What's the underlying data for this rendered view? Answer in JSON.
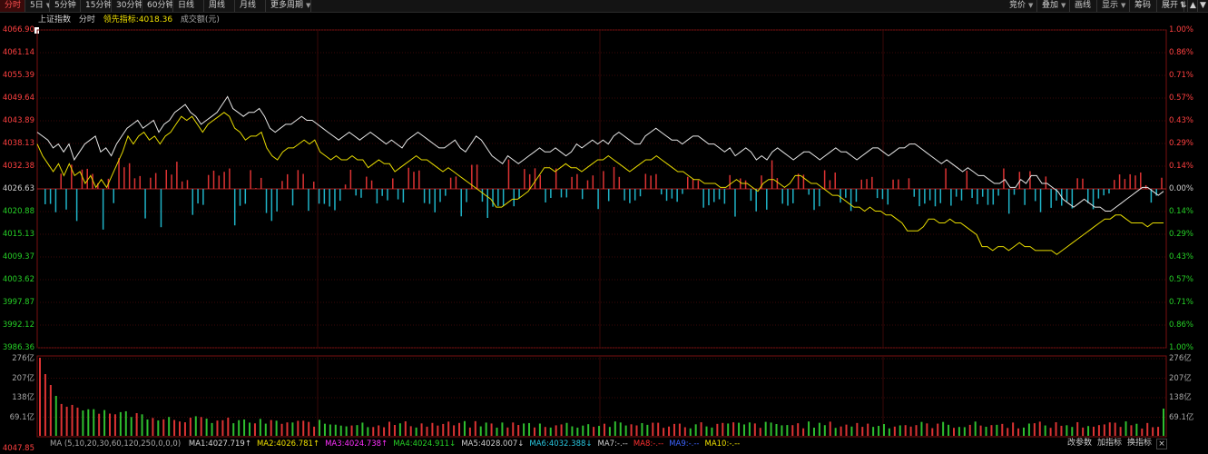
{
  "toolbar": {
    "left": [
      {
        "label": "分时",
        "active": true
      },
      {
        "label": "5日",
        "dropdown": true
      },
      {
        "label": "5分钟"
      },
      {
        "label": "15分钟"
      },
      {
        "label": "30分钟"
      },
      {
        "label": "60分钟"
      },
      {
        "label": "日线"
      },
      {
        "label": "周线"
      },
      {
        "label": "月线"
      },
      {
        "label": "更多周期",
        "dropdown": true
      }
    ],
    "right": [
      {
        "label": "竞价",
        "dropdown": true
      },
      {
        "label": "叠加",
        "dropdown": true
      },
      {
        "label": "画线"
      },
      {
        "label": "显示",
        "dropdown": true
      },
      {
        "label": "筹码"
      },
      {
        "label": "展开",
        "dropdown": true
      }
    ],
    "icons": [
      "sort-icon",
      "up-triangle-icon",
      "down-triangle-icon"
    ]
  },
  "header": {
    "name": "上证指数",
    "period": "分时",
    "indicator_label": "领先指标:",
    "indicator_value": "4018.36",
    "volume_label": "成交额(元)"
  },
  "price_axis_left": [
    "4066.90",
    "4061.14",
    "4055.39",
    "4049.64",
    "4043.89",
    "4038.13",
    "4032.38",
    "4026.63",
    "4020.88",
    "4015.13",
    "4009.37",
    "4003.62",
    "3997.87",
    "3992.12",
    "3986.36"
  ],
  "price_axis_right": [
    "1.00%",
    "0.86%",
    "0.71%",
    "0.57%",
    "0.43%",
    "0.29%",
    "0.14%",
    "0.00%",
    "0.14%",
    "0.29%",
    "0.43%",
    "0.57%",
    "0.71%",
    "0.86%",
    "1.00%"
  ],
  "volume_axis": [
    "276亿",
    "207亿",
    "138亿",
    "69.1亿"
  ],
  "bottom_value": "4047.85",
  "ma_legend": {
    "params": "MA (5,10,20,30,60,120,250,0,0,0)",
    "items": [
      {
        "label": "MA1:4027.719↑",
        "color": "#d8d8d8"
      },
      {
        "label": "MA2:4026.781↑",
        "color": "#f0e000"
      },
      {
        "label": "MA3:4024.738↑",
        "color": "#ff30ff"
      },
      {
        "label": "MA4:4024.911↓",
        "color": "#26d026"
      },
      {
        "label": "MA5:4028.007↓",
        "color": "#d0d0d0"
      },
      {
        "label": "MA6:4032.388↓",
        "color": "#29c7e0"
      },
      {
        "label": "MA7:-.--",
        "color": "#d0d0d0"
      },
      {
        "label": "MA8:-.--",
        "color": "#ff3030"
      },
      {
        "label": "MA9:-.--",
        "color": "#3c64ff"
      },
      {
        "label": "MA10:-.--",
        "color": "#f0e000"
      }
    ]
  },
  "bottom_buttons": [
    "改参数",
    "加指标",
    "换指标"
  ],
  "chart_data": {
    "type": "line",
    "title": "",
    "ylim": [
      3986.36,
      4066.9
    ],
    "baseline": 4026.63,
    "series": [
      {
        "values": [
          4041,
          4040,
          4039,
          4037,
          4038,
          4036,
          4038,
          4034,
          4036,
          4038,
          4039,
          4040,
          4036,
          4037,
          4035,
          4038,
          4040,
          4042,
          4043,
          4044,
          4042,
          4043,
          4044,
          4041,
          4043,
          4044,
          4046,
          4047,
          4048,
          4046,
          4045,
          4043,
          4044,
          4045,
          4046,
          4048,
          4050,
          4047,
          4046,
          4045,
          4046,
          4046,
          4047,
          4045,
          4042,
          4041,
          4042,
          4043,
          4043,
          4044,
          4045,
          4044,
          4044,
          4043,
          4042,
          4041,
          4040,
          4039,
          4040,
          4041,
          4040,
          4039,
          4040,
          4041,
          4040,
          4039,
          4038,
          4039,
          4038,
          4037,
          4039,
          4040,
          4041,
          4040,
          4039,
          4038,
          4037,
          4037,
          4038,
          4039,
          4037,
          4036,
          4038,
          4040,
          4039,
          4037,
          4035,
          4034,
          4033,
          4035,
          4034,
          4033,
          4034,
          4035,
          4036,
          4037,
          4036,
          4036,
          4037,
          4036,
          4035,
          4036,
          4038,
          4037,
          4038,
          4039,
          4038,
          4039,
          4038,
          4040,
          4041,
          4040,
          4039,
          4038,
          4038,
          4040,
          4041,
          4042,
          4041,
          4040,
          4039,
          4039,
          4038,
          4039,
          4040,
          4040,
          4039,
          4038,
          4038,
          4037,
          4036,
          4037,
          4035,
          4036,
          4037,
          4036,
          4034,
          4035,
          4034,
          4036,
          4037,
          4036,
          4035,
          4034,
          4035,
          4036,
          4036,
          4035,
          4034,
          4035,
          4036,
          4037,
          4036,
          4036,
          4035,
          4034,
          4035,
          4036,
          4037,
          4037,
          4036,
          4035,
          4036,
          4037,
          4037,
          4038,
          4038,
          4037,
          4036,
          4035,
          4034,
          4033,
          4034,
          4033,
          4032,
          4031,
          4032,
          4031,
          4030,
          4030,
          4029,
          4028,
          4028,
          4029,
          4027,
          4027,
          4029,
          4028,
          4030,
          4030,
          4028,
          4028,
          4027,
          4026,
          4024,
          4023,
          4022,
          4023,
          4024,
          4023,
          4022,
          4022,
          4021,
          4021,
          4022,
          4023,
          4024,
          4025,
          4026,
          4027,
          4027,
          4026,
          4025,
          4026
        ]
      },
      {
        "values": [
          4038,
          4035,
          4033,
          4031,
          4033,
          4030,
          4033,
          4030,
          4031,
          4028,
          4030,
          4027,
          4029,
          4027,
          4030,
          4033,
          4036,
          4040,
          4038,
          4040,
          4041,
          4039,
          4040,
          4038,
          4040,
          4041,
          4043,
          4045,
          4044,
          4045,
          4043,
          4041,
          4043,
          4044,
          4045,
          4046,
          4045,
          4042,
          4041,
          4039,
          4040,
          4040,
          4041,
          4037,
          4035,
          4034,
          4036,
          4037,
          4037,
          4038,
          4039,
          4038,
          4039,
          4036,
          4035,
          4034,
          4035,
          4034,
          4034,
          4035,
          4034,
          4034,
          4032,
          4033,
          4034,
          4033,
          4033,
          4031,
          4032,
          4033,
          4034,
          4035,
          4034,
          4034,
          4033,
          4032,
          4031,
          4032,
          4031,
          4030,
          4029,
          4028,
          4027,
          4026,
          4025,
          4024,
          4022,
          4022,
          4023,
          4024,
          4024,
          4025,
          4026,
          4028,
          4030,
          4032,
          4032,
          4031,
          4032,
          4033,
          4032,
          4032,
          4031,
          4032,
          4033,
          4034,
          4034,
          4035,
          4034,
          4033,
          4032,
          4031,
          4032,
          4033,
          4034,
          4034,
          4035,
          4034,
          4033,
          4032,
          4031,
          4031,
          4030,
          4029,
          4029,
          4028,
          4028,
          4028,
          4027,
          4027,
          4028,
          4029,
          4028,
          4028,
          4027,
          4026,
          4028,
          4029,
          4029,
          4028,
          4027,
          4028,
          4030,
          4030,
          4029,
          4028,
          4028,
          4027,
          4026,
          4025,
          4025,
          4024,
          4023,
          4022,
          4022,
          4021,
          4022,
          4021,
          4021,
          4020,
          4020,
          4019,
          4018,
          4016,
          4016,
          4016,
          4017,
          4019,
          4019,
          4018,
          4018,
          4019,
          4018,
          4018,
          4017,
          4016,
          4015,
          4012,
          4012,
          4011,
          4012,
          4012,
          4011,
          4012,
          4013,
          4012,
          4012,
          4011,
          4011,
          4011,
          4011,
          4010,
          4011,
          4012,
          4013,
          4014,
          4015,
          4016,
          4017,
          4018,
          4019,
          4019,
          4020,
          4020,
          4019,
          4018,
          4018,
          4018,
          4017,
          4018,
          4018,
          4018
        ]
      }
    ]
  }
}
